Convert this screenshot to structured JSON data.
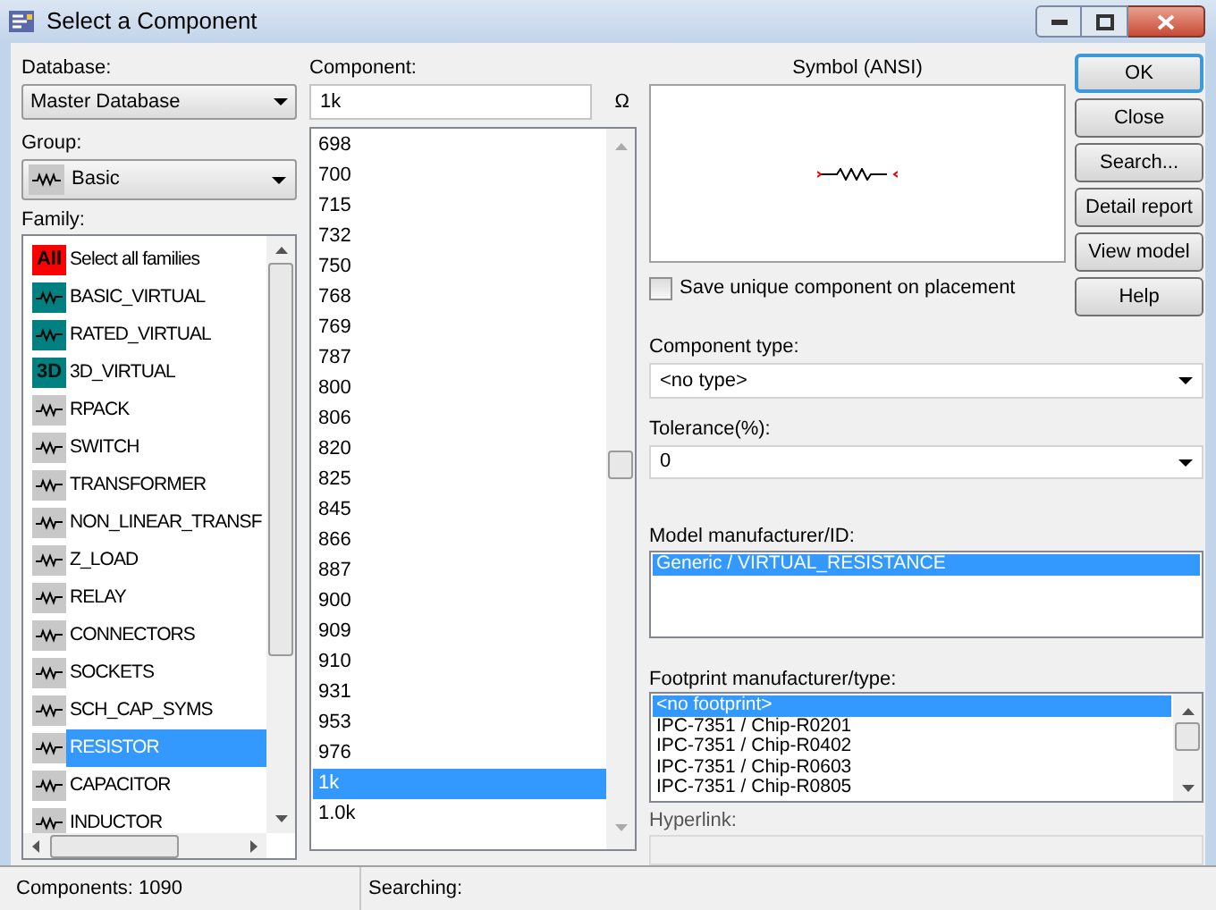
{
  "window": {
    "title": "Select a Component"
  },
  "database": {
    "label": "Database:",
    "value": "Master Database"
  },
  "group": {
    "label": "Group:",
    "value": "Basic"
  },
  "family": {
    "label": "Family:",
    "items": [
      {
        "label": "Select all families",
        "badge": "All",
        "color": "#ff0000",
        "selected": false
      },
      {
        "label": "BASIC_VIRTUAL",
        "color": "#008080",
        "selected": false
      },
      {
        "label": "RATED_VIRTUAL",
        "color": "#008080",
        "selected": false
      },
      {
        "label": "3D_VIRTUAL",
        "badge": "3D",
        "color": "#008080",
        "selected": false
      },
      {
        "label": "RPACK",
        "color": "#c8c8c8",
        "selected": false
      },
      {
        "label": "SWITCH",
        "color": "#c8c8c8",
        "selected": false
      },
      {
        "label": "TRANSFORMER",
        "color": "#c8c8c8",
        "selected": false
      },
      {
        "label": "NON_LINEAR_TRANSF",
        "color": "#c8c8c8",
        "selected": false
      },
      {
        "label": "Z_LOAD",
        "color": "#c8c8c8",
        "selected": false
      },
      {
        "label": "RELAY",
        "color": "#c8c8c8",
        "selected": false
      },
      {
        "label": "CONNECTORS",
        "color": "#c8c8c8",
        "selected": false
      },
      {
        "label": "SOCKETS",
        "color": "#c8c8c8",
        "selected": false
      },
      {
        "label": "SCH_CAP_SYMS",
        "color": "#c8c8c8",
        "selected": false
      },
      {
        "label": "RESISTOR",
        "color": "#c8c8c8",
        "selected": true
      },
      {
        "label": "CAPACITOR",
        "color": "#c8c8c8",
        "selected": false
      },
      {
        "label": "INDUCTOR",
        "color": "#c8c8c8",
        "selected": false
      }
    ]
  },
  "component": {
    "label": "Component:",
    "value": "1k",
    "unit": "Ω",
    "items": [
      {
        "label": "698",
        "selected": false
      },
      {
        "label": "700",
        "selected": false
      },
      {
        "label": "715",
        "selected": false
      },
      {
        "label": "732",
        "selected": false
      },
      {
        "label": "750",
        "selected": false
      },
      {
        "label": "768",
        "selected": false
      },
      {
        "label": "769",
        "selected": false
      },
      {
        "label": "787",
        "selected": false
      },
      {
        "label": "800",
        "selected": false
      },
      {
        "label": "806",
        "selected": false
      },
      {
        "label": "820",
        "selected": false
      },
      {
        "label": "825",
        "selected": false
      },
      {
        "label": "845",
        "selected": false
      },
      {
        "label": "866",
        "selected": false
      },
      {
        "label": "887",
        "selected": false
      },
      {
        "label": "900",
        "selected": false
      },
      {
        "label": "909",
        "selected": false
      },
      {
        "label": "910",
        "selected": false
      },
      {
        "label": "931",
        "selected": false
      },
      {
        "label": "953",
        "selected": false
      },
      {
        "label": "976",
        "selected": false
      },
      {
        "label": "1k",
        "selected": true
      },
      {
        "label": "1.0k",
        "selected": false
      }
    ]
  },
  "symbol": {
    "label": "Symbol (ANSI)"
  },
  "save_unique": {
    "label": "Save unique component on placement",
    "checked": false
  },
  "component_type": {
    "label": "Component type:",
    "value": "<no type>"
  },
  "tolerance": {
    "label": "Tolerance(%):",
    "value": "0"
  },
  "model": {
    "label": "Model manufacturer/ID:",
    "items": [
      {
        "label": "Generic / VIRTUAL_RESISTANCE",
        "selected": true
      }
    ]
  },
  "footprint": {
    "label": "Footprint manufacturer/type:",
    "items": [
      {
        "label": "<no footprint>",
        "selected": true
      },
      {
        "label": "IPC-7351 / Chip-R0201",
        "selected": false
      },
      {
        "label": "IPC-7351 / Chip-R0402",
        "selected": false
      },
      {
        "label": "IPC-7351 / Chip-R0603",
        "selected": false
      },
      {
        "label": "IPC-7351 / Chip-R0805",
        "selected": false
      }
    ]
  },
  "hyperlink": {
    "label": "Hyperlink:"
  },
  "buttons": [
    {
      "label": "OK",
      "default": true
    },
    {
      "label": "Close",
      "default": false
    },
    {
      "label": "Search...",
      "default": false
    },
    {
      "label": "Detail report",
      "default": false
    },
    {
      "label": "View model",
      "default": false
    },
    {
      "label": "Help",
      "default": false
    }
  ],
  "status_bar": {
    "components": "Components: 1090",
    "searching": "Searching:"
  }
}
